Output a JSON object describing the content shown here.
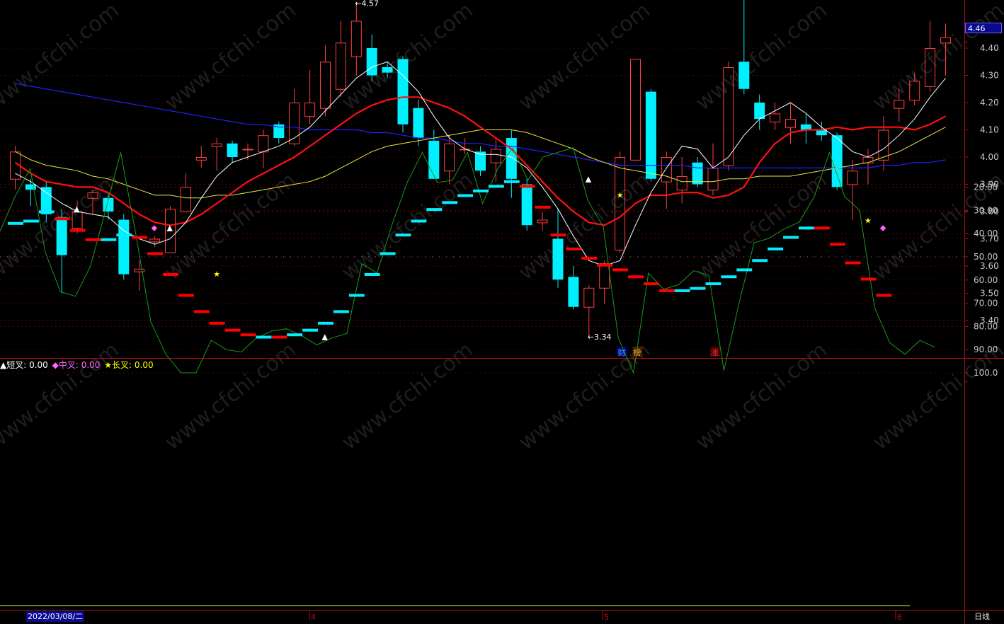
{
  "chart_data": [
    {
      "type": "candlestick",
      "ylim": [
        3.3,
        4.6
      ],
      "y_ticks": [
        "4.40",
        "4.30",
        "4.20",
        "4.10",
        "4.00",
        "3.90",
        "3.80",
        "3.70",
        "3.60",
        "3.50",
        "3.40"
      ],
      "current_price": "4.46",
      "high_label": "4.57",
      "low_label": "3.34",
      "candles": [
        [
          3.92,
          4.02,
          3.88,
          4.04
        ],
        [
          3.9,
          3.88,
          3.82,
          3.92
        ],
        [
          3.89,
          3.79,
          3.76,
          3.91
        ],
        [
          3.78,
          3.64,
          3.5,
          3.81
        ],
        [
          3.74,
          3.8,
          3.72,
          3.84
        ],
        [
          3.85,
          3.87,
          3.79,
          3.88
        ],
        [
          3.85,
          3.8,
          3.77,
          3.87
        ],
        [
          3.77,
          3.57,
          3.55,
          3.79
        ],
        [
          3.58,
          3.59,
          3.51,
          3.62
        ],
        [
          3.69,
          3.7,
          3.67,
          3.71
        ],
        [
          3.65,
          3.81,
          3.65,
          3.82
        ],
        [
          3.8,
          3.89,
          3.8,
          3.94
        ],
        [
          3.99,
          4.0,
          3.96,
          4.04
        ],
        [
          4.04,
          4.05,
          3.95,
          4.07
        ],
        [
          4.05,
          4.0,
          3.98,
          4.06
        ],
        [
          4.03,
          4.03,
          3.99,
          4.05
        ],
        [
          4.02,
          4.08,
          3.96,
          4.1
        ],
        [
          4.12,
          4.07,
          4.05,
          4.13
        ],
        [
          4.05,
          4.2,
          4.04,
          4.25
        ],
        [
          4.15,
          4.2,
          4.12,
          4.32
        ],
        [
          4.18,
          4.35,
          4.15,
          4.41
        ],
        [
          4.25,
          4.42,
          4.22,
          4.5
        ],
        [
          4.37,
          4.5,
          4.3,
          4.57
        ],
        [
          4.4,
          4.3,
          4.28,
          4.45
        ],
        [
          4.33,
          4.31,
          4.29,
          4.35
        ],
        [
          4.36,
          4.12,
          4.09,
          4.37
        ],
        [
          4.18,
          4.07,
          4.04,
          4.21
        ],
        [
          4.06,
          3.92,
          3.92,
          4.1
        ],
        [
          3.95,
          4.05,
          3.9,
          4.08
        ],
        [
          4.03,
          4.03,
          4.01,
          4.07
        ],
        [
          4.02,
          3.95,
          3.93,
          4.04
        ],
        [
          3.98,
          4.03,
          3.91,
          4.07
        ],
        [
          4.07,
          3.92,
          3.85,
          4.1
        ],
        [
          3.9,
          3.75,
          3.73,
          3.92
        ],
        [
          3.76,
          3.77,
          3.73,
          3.8
        ],
        [
          3.7,
          3.55,
          3.52,
          3.81
        ],
        [
          3.56,
          3.45,
          3.44,
          3.6
        ],
        [
          3.45,
          3.52,
          3.34,
          3.53
        ],
        [
          3.52,
          3.61,
          3.46,
          3.62
        ],
        [
          3.66,
          4.0,
          3.65,
          4.02
        ],
        [
          3.99,
          4.36,
          3.99,
          4.36
        ],
        [
          4.24,
          3.92,
          3.91,
          4.25
        ],
        [
          3.91,
          4.0,
          3.81,
          4.02
        ],
        [
          3.88,
          3.93,
          3.83,
          4.0
        ],
        [
          3.98,
          3.9,
          3.89,
          4.0
        ],
        [
          3.88,
          3.96,
          3.86,
          4.05
        ],
        [
          3.97,
          4.33,
          3.95,
          4.35
        ],
        [
          4.35,
          4.25,
          4.23,
          4.6
        ],
        [
          4.2,
          4.14,
          4.1,
          4.23
        ],
        [
          4.13,
          4.16,
          4.1,
          4.2
        ],
        [
          4.11,
          4.14,
          4.05,
          4.2
        ],
        [
          4.12,
          4.1,
          4.05,
          4.16
        ],
        [
          4.1,
          4.08,
          4.06,
          4.13
        ],
        [
          4.08,
          3.89,
          3.88,
          4.09
        ],
        [
          3.9,
          3.95,
          3.77,
          3.99
        ],
        [
          3.98,
          4.0,
          3.9,
          4.03
        ],
        [
          3.99,
          4.1,
          3.95,
          4.15
        ],
        [
          4.18,
          4.21,
          4.13,
          4.25
        ],
        [
          4.21,
          4.28,
          4.19,
          4.31
        ],
        [
          4.26,
          4.4,
          4.24,
          4.5
        ],
        [
          4.42,
          4.44,
          4.3,
          4.49
        ]
      ],
      "ma_white": [
        3.94,
        3.91,
        3.87,
        3.83,
        3.8,
        3.79,
        3.78,
        3.73,
        3.7,
        3.68,
        3.7,
        3.76,
        3.85,
        3.93,
        3.98,
        4.0,
        4.02,
        4.04,
        4.07,
        4.11,
        4.17,
        4.23,
        4.29,
        4.33,
        4.35,
        4.3,
        4.24,
        4.15,
        4.07,
        4.03,
        4.01,
        4.01,
        4.0,
        3.96,
        3.89,
        3.81,
        3.71,
        3.62,
        3.6,
        3.62,
        3.75,
        3.87,
        3.96,
        4.04,
        4.03,
        3.96,
        4.0,
        4.08,
        4.14,
        4.17,
        4.2,
        4.16,
        4.11,
        4.07,
        4.02,
        4.0,
        4.03,
        4.08,
        4.14,
        4.22,
        4.29
      ],
      "ma_red": [
        3.98,
        3.94,
        3.91,
        3.9,
        3.89,
        3.89,
        3.87,
        3.83,
        3.79,
        3.76,
        3.75,
        3.76,
        3.79,
        3.83,
        3.87,
        3.91,
        3.94,
        3.97,
        4.0,
        4.04,
        4.08,
        4.12,
        4.16,
        4.19,
        4.21,
        4.22,
        4.22,
        4.2,
        4.18,
        4.15,
        4.11,
        4.07,
        4.03,
        3.97,
        3.91,
        3.85,
        3.8,
        3.76,
        3.75,
        3.78,
        3.83,
        3.86,
        3.86,
        3.87,
        3.87,
        3.85,
        3.86,
        3.89,
        3.98,
        4.05,
        4.09,
        4.1,
        4.1,
        4.11,
        4.1,
        4.11,
        4.11,
        4.11,
        4.1,
        4.12,
        4.15
      ],
      "ma_yellow": [
        4.02,
        3.99,
        3.97,
        3.96,
        3.95,
        3.93,
        3.92,
        3.9,
        3.88,
        3.86,
        3.86,
        3.85,
        3.85,
        3.86,
        3.86,
        3.87,
        3.88,
        3.89,
        3.9,
        3.91,
        3.93,
        3.96,
        3.99,
        4.02,
        4.04,
        4.05,
        4.06,
        4.07,
        4.08,
        4.09,
        4.1,
        4.1,
        4.1,
        4.09,
        4.07,
        4.05,
        4.03,
        4.0,
        3.98,
        3.96,
        3.95,
        3.94,
        3.93,
        3.91,
        3.91,
        3.91,
        3.92,
        3.92,
        3.93,
        3.93,
        3.93,
        3.94,
        3.95,
        3.96,
        3.97,
        3.98,
        4.0,
        4.02,
        4.05,
        4.08,
        4.11
      ],
      "ma_blue": [
        4.27,
        4.26,
        4.25,
        4.24,
        4.23,
        4.22,
        4.21,
        4.2,
        4.19,
        4.18,
        4.17,
        4.16,
        4.15,
        4.14,
        4.13,
        4.12,
        4.12,
        4.11,
        4.11,
        4.1,
        4.1,
        4.1,
        4.1,
        4.09,
        4.09,
        4.08,
        4.07,
        4.07,
        4.06,
        4.05,
        4.05,
        4.04,
        4.04,
        4.03,
        4.02,
        4.01,
        4.0,
        3.99,
        3.98,
        3.97,
        3.97,
        3.97,
        3.97,
        3.97,
        3.96,
        3.96,
        3.96,
        3.96,
        3.96,
        3.96,
        3.96,
        3.96,
        3.96,
        3.96,
        3.96,
        3.96,
        3.97,
        3.97,
        3.98,
        3.98,
        3.99
      ],
      "markers": [
        {
          "text": "财",
          "color": "#4da6ff"
        },
        {
          "text": "榜",
          "color": "#ffa040"
        },
        {
          "text": "涨",
          "color": "#ff3030"
        }
      ]
    },
    {
      "type": "oscillator",
      "ylim": [
        0,
        105
      ],
      "y_ticks": [
        "100.0",
        "90.00",
        "80.00",
        "70.00",
        "60.00",
        "50.00",
        "40.00",
        "30.00",
        "20.00"
      ],
      "legend": [
        {
          "text": "▲短叉: 0.00",
          "color": "#ffffff"
        },
        {
          "text": "◆中叉: 0.00",
          "color": "#ff66ff"
        },
        {
          "text": "★长叉: 0.00",
          "color": "#ffff00"
        }
      ],
      "blocks": [
        [
          35,
          34,
          "#00f0ff"
        ],
        [
          34,
          30,
          "#00f0ff"
        ],
        [
          30,
          29,
          "#00f0ff"
        ],
        [
          29,
          33,
          "#ff0000"
        ],
        [
          33,
          38,
          "#ff0000"
        ],
        [
          38,
          42,
          "#ff0000"
        ],
        [
          42,
          40,
          "#00f0ff"
        ],
        [
          40,
          37,
          "#00f0ff"
        ],
        [
          37,
          41,
          "#ff0000"
        ],
        [
          41,
          48,
          "#ff0000"
        ],
        [
          48,
          57,
          "#ff0000"
        ],
        [
          57,
          66,
          "#ff0000"
        ],
        [
          66,
          73,
          "#ff0000"
        ],
        [
          73,
          78,
          "#ff0000"
        ],
        [
          78,
          81,
          "#ff0000"
        ],
        [
          81,
          83,
          "#ff0000"
        ],
        [
          83,
          84,
          "#00f0ff"
        ],
        [
          84,
          83,
          "#ff0000"
        ],
        [
          83,
          81,
          "#00f0ff"
        ],
        [
          81,
          78,
          "#00f0ff"
        ],
        [
          78,
          73,
          "#00f0ff"
        ],
        [
          73,
          66,
          "#00f0ff"
        ],
        [
          66,
          57,
          "#00f0ff"
        ],
        [
          57,
          48,
          "#00f0ff"
        ],
        [
          48,
          40,
          "#00f0ff"
        ],
        [
          40,
          34,
          "#00f0ff"
        ],
        [
          34,
          29,
          "#00f0ff"
        ],
        [
          29,
          26,
          "#00f0ff"
        ],
        [
          26,
          23,
          "#00f0ff"
        ],
        [
          23,
          21,
          "#00f0ff"
        ],
        [
          21,
          19,
          "#00f0ff"
        ],
        [
          19,
          17,
          "#00f0ff"
        ],
        [
          17,
          16,
          "#00f0ff"
        ],
        [
          16,
          19,
          "#ff0000"
        ],
        [
          19,
          28,
          "#ff0000"
        ],
        [
          28,
          40,
          "#ff0000"
        ],
        [
          40,
          46,
          "#ff0000"
        ],
        [
          46,
          50,
          "#ff0000"
        ],
        [
          50,
          53,
          "#ff0000"
        ],
        [
          53,
          55,
          "#ff0000"
        ],
        [
          55,
          58,
          "#ff0000"
        ],
        [
          58,
          61,
          "#ff0000"
        ],
        [
          61,
          64,
          "#ff0000"
        ],
        [
          64,
          63,
          "#00f0ff"
        ],
        [
          63,
          61,
          "#00f0ff"
        ],
        [
          61,
          58,
          "#00f0ff"
        ],
        [
          58,
          55,
          "#00f0ff"
        ],
        [
          55,
          51,
          "#00f0ff"
        ],
        [
          51,
          46,
          "#00f0ff"
        ],
        [
          46,
          41,
          "#00f0ff"
        ],
        [
          41,
          37,
          "#00f0ff"
        ],
        [
          37,
          34,
          "#00f0ff"
        ],
        [
          34,
          37,
          "#ff0000"
        ],
        [
          37,
          44,
          "#ff0000"
        ],
        [
          44,
          52,
          "#ff0000"
        ],
        [
          52,
          59,
          "#ff0000"
        ],
        [
          59,
          66,
          "#ff0000"
        ]
      ],
      "green_line": [
        39,
        24,
        12,
        48,
        65,
        67,
        54,
        30,
        5,
        40,
        78,
        92,
        100,
        100,
        86,
        90,
        91,
        85,
        82,
        81,
        84,
        88,
        85,
        83,
        53,
        57,
        36,
        18,
        5,
        18,
        17,
        5,
        27,
        12,
        3,
        17,
        7,
        5,
        3,
        26,
        37,
        85,
        100,
        57,
        64,
        62,
        56,
        58,
        99,
        70,
        44,
        42,
        38,
        35,
        24,
        5,
        24,
        30,
        72,
        87,
        92,
        86,
        89
      ],
      "signals": [
        {
          "i": 4,
          "shape": "▲",
          "color": "#ffffff",
          "v": 29
        },
        {
          "i": 9,
          "shape": "◆",
          "color": "#ff66ff",
          "v": 37
        },
        {
          "i": 10,
          "shape": "▲",
          "color": "#ffffff",
          "v": 37
        },
        {
          "i": 13,
          "shape": "★",
          "color": "#ffff00",
          "v": 57
        },
        {
          "i": 20,
          "shape": "▲",
          "color": "#ffffff",
          "v": 84
        },
        {
          "i": 37,
          "shape": "▲",
          "color": "#ffffff",
          "v": 16
        },
        {
          "i": 39,
          "shape": "★",
          "color": "#ffff00",
          "v": 23
        },
        {
          "i": 55,
          "shape": "★",
          "color": "#ffff00",
          "v": 34
        },
        {
          "i": 56,
          "shape": "◆",
          "color": "#ff66ff",
          "v": 37
        }
      ]
    }
  ],
  "x_axis": {
    "date_label": "2022/03/08/二",
    "months": [
      "4",
      "5",
      "6"
    ],
    "period_label": "日线"
  },
  "watermark": "www.cfchi.com"
}
